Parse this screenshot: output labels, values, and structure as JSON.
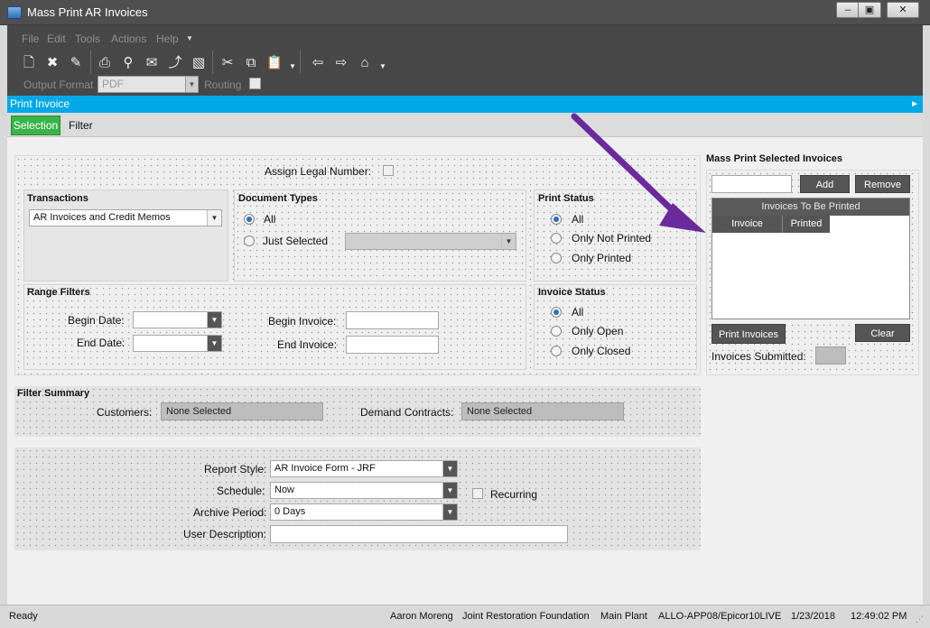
{
  "window": {
    "title": "Mass Print AR Invoices",
    "buttons": {
      "minimize": "–",
      "restore": "▣",
      "close": "✕"
    }
  },
  "menu": [
    "File",
    "Edit",
    "Tools",
    "Actions",
    "Help"
  ],
  "toolbar": {
    "icons": [
      "new-icon",
      "delete-icon",
      "clear-icon",
      "print-icon",
      "print-preview-icon",
      "email-icon",
      "generate-icon",
      "fax-icon",
      "cut-icon",
      "copy-icon",
      "paste-icon",
      "back-icon",
      "forward-icon",
      "home-icon"
    ],
    "output_format_label": "Output Format",
    "output_format_value": "PDF",
    "routing_label": "Routing"
  },
  "panel_title": "Print Invoice",
  "tabs": {
    "selection": "Selection",
    "filter": "Filter"
  },
  "assign_legal_number_label": "Assign Legal Number:",
  "transactions": {
    "title": "Transactions",
    "value": "AR Invoices and Credit Memos"
  },
  "document_types": {
    "title": "Document Types",
    "all": "All",
    "just_selected": "Just Selected"
  },
  "print_status": {
    "title": "Print Status",
    "all": "All",
    "only_not_printed": "Only Not Printed",
    "only_printed": "Only Printed"
  },
  "range_filters": {
    "title": "Range Filters",
    "begin_date": "Begin Date:",
    "end_date": "End Date:",
    "begin_invoice": "Begin Invoice:",
    "end_invoice": "End Invoice:"
  },
  "invoice_status": {
    "title": "Invoice Status",
    "all": "All",
    "only_open": "Only Open",
    "only_closed": "Only Closed"
  },
  "filter_summary": {
    "title": "Filter Summary",
    "customers_label": "Customers:",
    "customers_value": "None Selected",
    "demand_contracts_label": "Demand Contracts:",
    "demand_contracts_value": "None Selected"
  },
  "report": {
    "style_label": "Report Style:",
    "style_value": "AR Invoice Form - JRF",
    "schedule_label": "Schedule:",
    "schedule_value": "Now",
    "recurring_label": "Recurring",
    "archive_label": "Archive Period:",
    "archive_value": "0 Days",
    "user_desc_label": "User Description:"
  },
  "mass_print": {
    "title": "Mass Print Selected Invoices",
    "add": "Add",
    "remove": "Remove",
    "grid_title": "Invoices To Be Printed",
    "columns": [
      "Invoice",
      "Printed"
    ],
    "print_invoices": "Print Invoices",
    "clear": "Clear",
    "submitted_label": "Invoices Submitted:"
  },
  "status_bar": {
    "state": "Ready",
    "user": "Aaron Moreng",
    "company": "Joint Restoration Foundation",
    "plant": "Main Plant",
    "server": "ALLO-APP08/Epicor10LIVE",
    "date": "1/23/2018",
    "time": "12:49:02 PM"
  },
  "colors": {
    "accent": "#00a9e6",
    "tab_active": "#3ab44a",
    "annotation_arrow": "#6a2a9c"
  }
}
